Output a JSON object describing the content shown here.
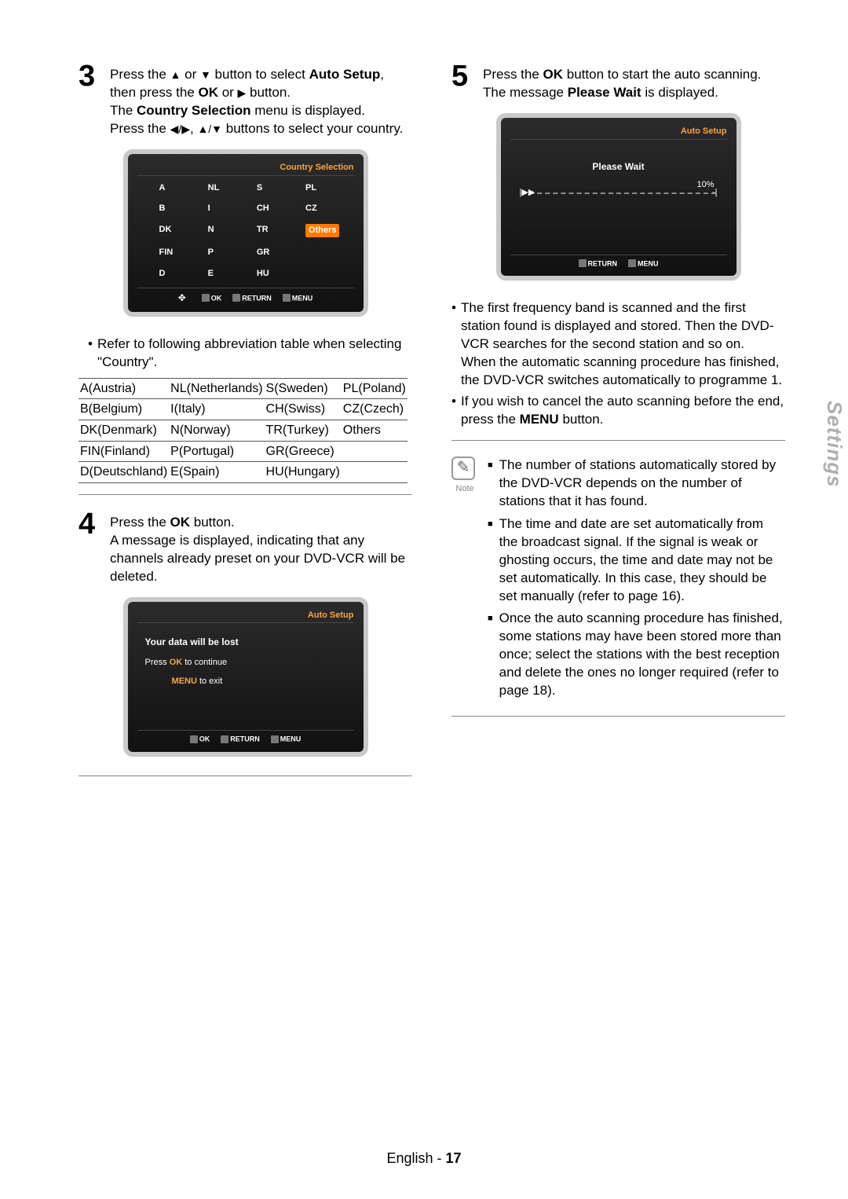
{
  "sidebar_tab": "Settings",
  "footer_lang": "English",
  "footer_page": "17",
  "step3": {
    "num": "3",
    "text1a": "Press the ",
    "text1b": " or ",
    "text1c": " button to select ",
    "bold1": "Auto Setup",
    "text1d": ", then press the ",
    "bold2": "OK",
    "text1e": " or ",
    "text1f": " button.",
    "text2a": "The ",
    "bold3": "Country Selection",
    "text2b": " menu is displayed.",
    "text3a": "Press the ",
    "text3b": ", ",
    "text3c": " buttons to select your country."
  },
  "tv1": {
    "title": "Country Selection",
    "grid": [
      "A",
      "NL",
      "S",
      "PL",
      "B",
      "I",
      "CH",
      "CZ",
      "DK",
      "N",
      "TR",
      "Others",
      "FIN",
      "P",
      "GR",
      "",
      "D",
      "E",
      "HU",
      ""
    ],
    "selected_index": 11,
    "foot_ok": "OK",
    "foot_return": "RETURN",
    "foot_menu": "MENU"
  },
  "abbr_note_a": "Refer to following abbreviation table when selecting \"Country\".",
  "abbr_table": [
    [
      "A(Austria)",
      "NL(Netherlands)",
      "S(Sweden)",
      "PL(Poland)"
    ],
    [
      "B(Belgium)",
      "I(Italy)",
      "CH(Swiss)",
      "CZ(Czech)"
    ],
    [
      "DK(Denmark)",
      "N(Norway)",
      "TR(Turkey)",
      "Others"
    ],
    [
      "FIN(Finland)",
      "P(Portugal)",
      "GR(Greece)",
      ""
    ],
    [
      "D(Deutschland)",
      "E(Spain)",
      "HU(Hungary)",
      ""
    ]
  ],
  "step4": {
    "num": "4",
    "text1a": "Press the ",
    "bold1": "OK",
    "text1b": " button.",
    "text2": "A message is displayed, indicating that any channels already preset on your DVD-VCR will be deleted."
  },
  "tv2": {
    "title": "Auto Setup",
    "line1": "Your data will be lost",
    "line2a": "Press ",
    "line2hl": "OK",
    "line2b": "  to continue",
    "line3hl": "MENU",
    "line3b": "  to exit",
    "foot_ok": "OK",
    "foot_return": "RETURN",
    "foot_menu": "MENU"
  },
  "step5": {
    "num": "5",
    "text1a": "Press the ",
    "bold1": "OK",
    "text1b": " button to start the auto scanning. The message ",
    "bold2": "Please Wait",
    "text1c": " is displayed."
  },
  "tv3": {
    "title": "Auto Setup",
    "wait": "Please Wait",
    "pct": "10%",
    "foot_return": "RETURN",
    "foot_menu": "MENU"
  },
  "post5": {
    "b1": "The first frequency band is scanned and the first station found is displayed and stored. Then the DVD-VCR searches for the second station and so on.",
    "b1b": "When the automatic scanning procedure has finished, the DVD-VCR switches automatically to programme 1.",
    "b2a": "If you wish to cancel the auto scanning before the end, press the ",
    "b2bold": "MENU",
    "b2b": " button."
  },
  "note": {
    "label": "Note",
    "n1": "The number of stations automatically stored by the DVD-VCR depends on the number of stations that it has found.",
    "n2": "The time and date are set automatically from the broadcast signal. If the signal is weak or ghosting occurs, the time and date may not be set automatically. In this case, they should be set manually (refer to page 16).",
    "n3": "Once the auto scanning procedure has finished, some stations may have been stored more than once; select the stations with the best reception and delete the ones no longer required (refer to page 18)."
  }
}
